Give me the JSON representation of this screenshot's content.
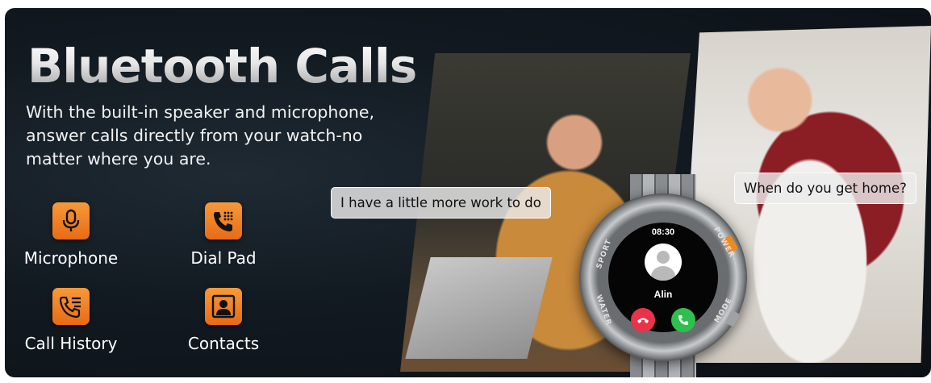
{
  "title": "Bluetooth Calls",
  "description": "With the built-in speaker and microphone, answer calls directly from your watch-no matter where you are.",
  "features": [
    {
      "label": "Microphone",
      "icon": "microphone-icon"
    },
    {
      "label": "Dial Pad",
      "icon": "dial-pad-icon"
    },
    {
      "label": "Call History",
      "icon": "call-history-icon"
    },
    {
      "label": "Contacts",
      "icon": "contacts-icon"
    }
  ],
  "bubbles": {
    "left": "I have a little more work to do",
    "right": "When do you get home?"
  },
  "watch": {
    "time": "08:30",
    "caller_name": "Alin",
    "bezel_labels": [
      "SPORT",
      "POWER",
      "MODE",
      "WATER"
    ]
  },
  "colors": {
    "accent_orange": "#ee7a1f",
    "background": "#121a21",
    "decline_red": "#e8334a",
    "accept_green": "#2fbf4d"
  }
}
